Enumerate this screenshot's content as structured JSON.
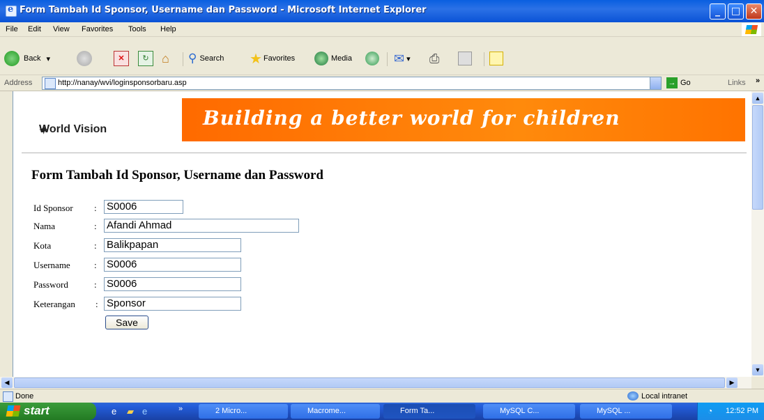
{
  "window": {
    "title": "Form Tambah Id Sponsor, Username dan Password - Microsoft Internet Explorer"
  },
  "menu": [
    "File",
    "Edit",
    "View",
    "Favorites",
    "Tools",
    "Help"
  ],
  "toolbar": {
    "back": "Back",
    "search": "Search",
    "favorites": "Favorites",
    "media": "Media"
  },
  "address": {
    "label": "Address",
    "url": "http://nanay/wvi/loginsponsorbaru.asp",
    "go": "Go",
    "links": "Links"
  },
  "banner": {
    "logo": "World Vision",
    "slogan": "Building a better world for children"
  },
  "form": {
    "title": "Form Tambah Id Sponsor, Username dan Password",
    "fields": [
      {
        "label": "Id Sponsor",
        "value": "S0006"
      },
      {
        "label": "Nama",
        "value": "Afandi Ahmad"
      },
      {
        "label": "Kota",
        "value": "Balikpapan"
      },
      {
        "label": "Username",
        "value": "S0006"
      },
      {
        "label": "Password",
        "value": "S0006"
      },
      {
        "label": "Keterangan",
        "value": "Sponsor"
      }
    ],
    "colon": ":",
    "save": "Save"
  },
  "status": {
    "text": "Done",
    "zone": "Local intranet"
  },
  "taskbar": {
    "start": "start",
    "tasks": [
      "2 Micro...",
      "Macrome...",
      "Form Ta...",
      "MySQL C...",
      "MySQL ..."
    ],
    "clock": "12:52 PM"
  },
  "colors": {
    "titlebar": "#0a5fe0",
    "banner": "#ff7300",
    "taskbar": "#245edb",
    "start": "#2f8c2f"
  }
}
